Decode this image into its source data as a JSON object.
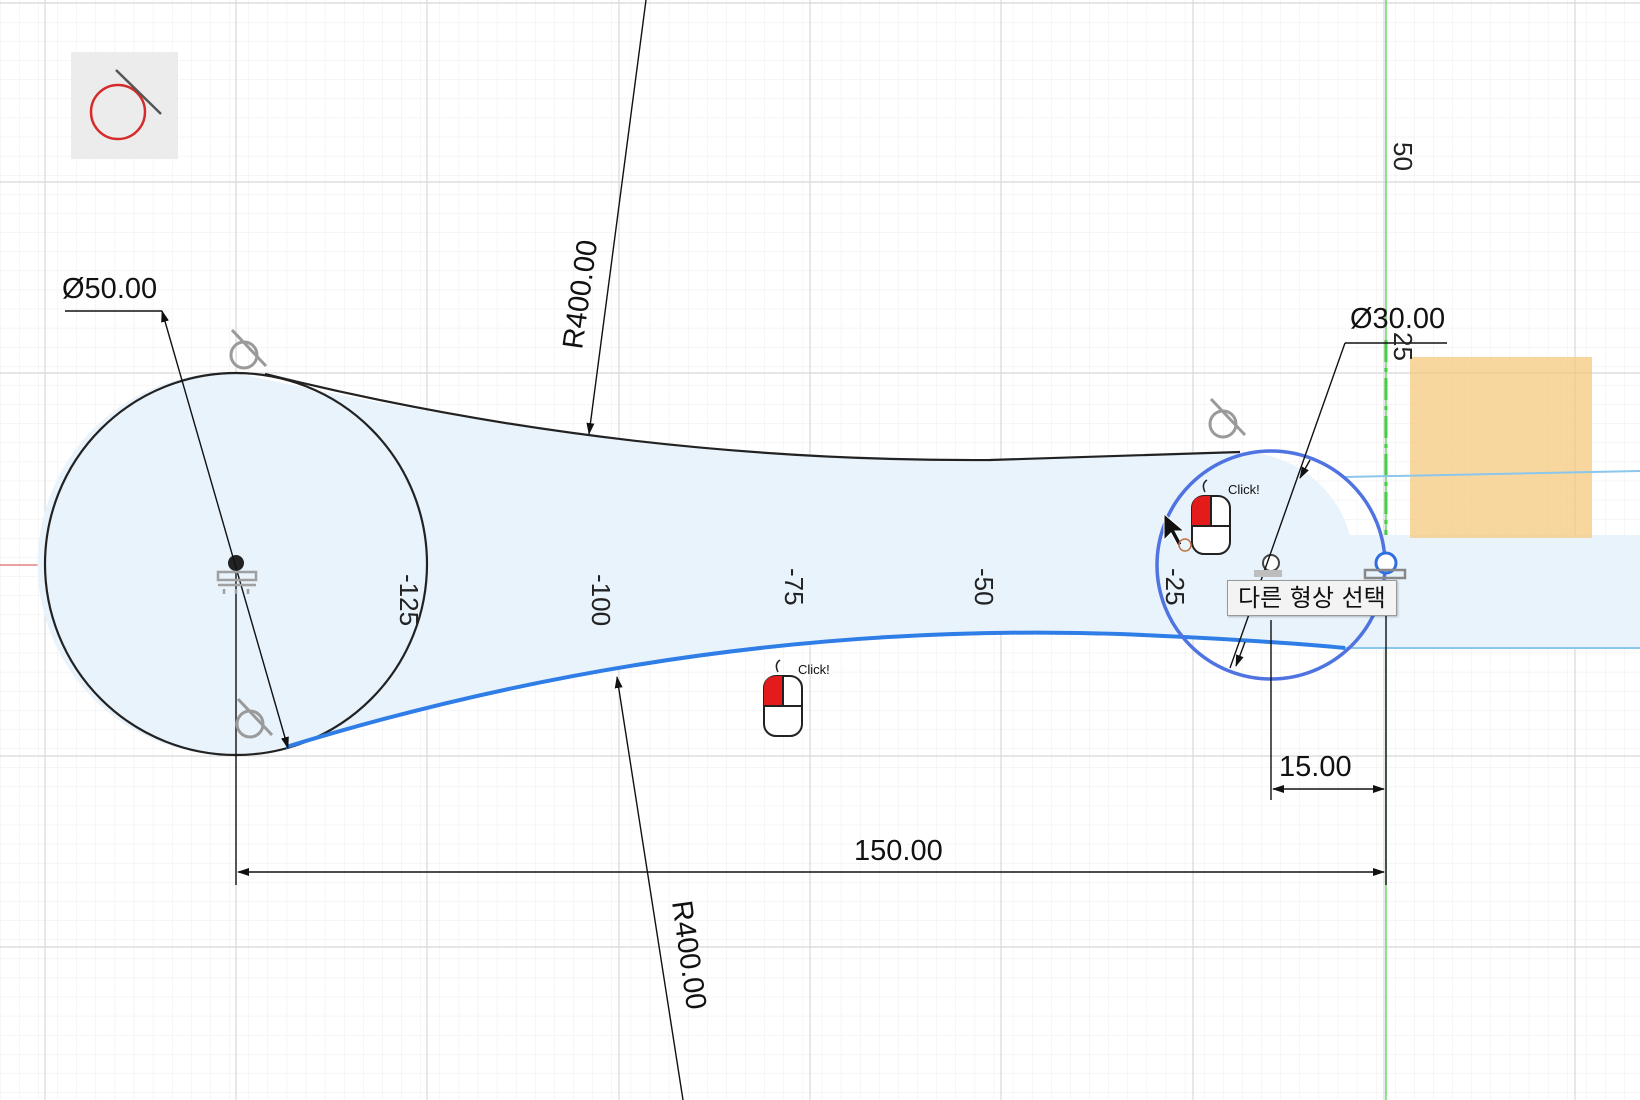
{
  "active_tool": {
    "icon": "tangent-circle-icon",
    "color": "#d62b2b"
  },
  "axis_labels": {
    "x": [
      "-125",
      "-100",
      "-75",
      "-50",
      "-25"
    ],
    "y": [
      "50",
      "25"
    ]
  },
  "dimensions": {
    "large_circle_diameter": "Ø50.00",
    "small_circle_diameter": "Ø30.00",
    "top_arc_radius": "R400.00",
    "bottom_arc_radius": "R400.00",
    "small_offset": "15.00",
    "center_distance": "150.00"
  },
  "click_hints": [
    {
      "label": "Click!"
    },
    {
      "label": "Click!"
    }
  ],
  "tooltip": {
    "text": "다른 형상 선택"
  },
  "colors": {
    "grid_minor": "#ebebeb",
    "grid_major": "#d6d6d6",
    "x_axis": "#d94444",
    "y_axis": "#5ed45e",
    "profile_fill": "#e8f3fc",
    "selected_curve": "#2f7de6",
    "highlight_circle": "#4f73e0",
    "selection_box": "#f5c77a"
  }
}
